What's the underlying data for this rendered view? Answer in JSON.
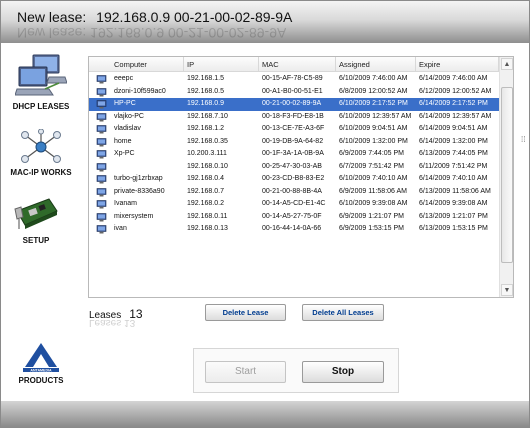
{
  "header": {
    "label": "New lease:",
    "ip": "192.168.0.9",
    "mac": "00-21-00-02-89-9A"
  },
  "sidebar": {
    "items": [
      {
        "label": "DHCP LEASES",
        "icon": "network-computers-icon"
      },
      {
        "label": "MAC-IP WORKS",
        "icon": "network-nodes-icon"
      },
      {
        "label": "SETUP",
        "icon": "network-card-icon"
      },
      {
        "label": "PRODUCTS",
        "icon": "antamedia-logo"
      }
    ],
    "brand": "ANTAMEDIA"
  },
  "table": {
    "columns": [
      "Computer",
      "IP",
      "MAC",
      "Assigned",
      "Expire"
    ],
    "selected_index": 2,
    "rows": [
      {
        "computer": "eeepc",
        "ip": "192.168.1.5",
        "mac": "00-15-AF-78-C5-89",
        "assigned": "6/10/2009 7:46:00 AM",
        "expire": "6/14/2009 7:46:00 AM"
      },
      {
        "computer": "dzoni-10f599ac0",
        "ip": "192.168.0.5",
        "mac": "00-A1-B0-00-51-E1",
        "assigned": "6/8/2009 12:00:52 AM",
        "expire": "6/12/2009 12:00:52 AM"
      },
      {
        "computer": "HP-PC",
        "ip": "192.168.0.9",
        "mac": "00-21-00-02-89-9A",
        "assigned": "6/10/2009 2:17:52 PM",
        "expire": "6/14/2009 2:17:52 PM"
      },
      {
        "computer": "vlajko-PC",
        "ip": "192.168.7.10",
        "mac": "00-18-F3-FD-E8-1B",
        "assigned": "6/10/2009 12:39:57 AM",
        "expire": "6/14/2009 12:39:57 AM"
      },
      {
        "computer": "vladislav",
        "ip": "192.168.1.2",
        "mac": "00-13-CE-7E-A3-6F",
        "assigned": "6/10/2009 9:04:51 AM",
        "expire": "6/14/2009 9:04:51 AM"
      },
      {
        "computer": "home",
        "ip": "192.168.0.35",
        "mac": "00-19-DB-9A-64-82",
        "assigned": "6/10/2009 1:32:00 PM",
        "expire": "6/14/2009 1:32:00 PM"
      },
      {
        "computer": "Xp-PC",
        "ip": "10.200.3.111",
        "mac": "00-1F-3A-1A-0B-9A",
        "assigned": "6/9/2009 7:44:05 PM",
        "expire": "6/13/2009 7:44:05 PM"
      },
      {
        "computer": "",
        "ip": "192.168.0.10",
        "mac": "00-25-47-30-03-AB",
        "assigned": "6/7/2009 7:51:42 PM",
        "expire": "6/11/2009 7:51:42 PM"
      },
      {
        "computer": "turbo-gj1zrbxap",
        "ip": "192.168.0.4",
        "mac": "00-23-CD-B8-83-E2",
        "assigned": "6/10/2009 7:40:10 AM",
        "expire": "6/14/2009 7:40:10 AM"
      },
      {
        "computer": "private-8336a90",
        "ip": "192.168.0.7",
        "mac": "00-21-00-88-8B-4A",
        "assigned": "6/9/2009 11:58:06 AM",
        "expire": "6/13/2009 11:58:06 AM"
      },
      {
        "computer": "Ivanam",
        "ip": "192.168.0.2",
        "mac": "00-14-A5-CD-E1-4C",
        "assigned": "6/10/2009 9:39:08 AM",
        "expire": "6/14/2009 9:39:08 AM"
      },
      {
        "computer": "mixersystem",
        "ip": "192.168.0.11",
        "mac": "00-14-A5-27-75-0F",
        "assigned": "6/9/2009 1:21:07 PM",
        "expire": "6/13/2009 1:21:07 PM"
      },
      {
        "computer": "ivan",
        "ip": "192.168.0.13",
        "mac": "00-16-44-14-0A-66",
        "assigned": "6/9/2009 1:53:15 PM",
        "expire": "6/13/2009 1:53:15 PM"
      }
    ]
  },
  "leases": {
    "label": "Leases",
    "count": "13"
  },
  "buttons": {
    "delete_lease": "Delete Lease",
    "delete_all": "Delete All Leases",
    "start": "Start",
    "stop": "Stop"
  },
  "colors": {
    "selection": "#3a6fc9",
    "button_text": "#003c8f"
  }
}
